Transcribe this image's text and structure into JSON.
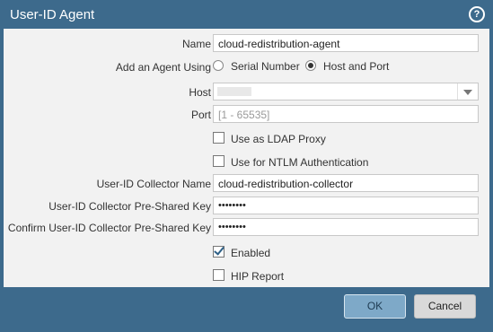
{
  "dialog": {
    "title": "User-ID Agent",
    "help_icon": "help-circle-icon"
  },
  "fields": {
    "name": {
      "label": "Name",
      "value": "cloud-redistribution-agent"
    },
    "add_agent_using": {
      "label": "Add an Agent Using",
      "options": [
        "Serial Number",
        "Host and Port"
      ],
      "selected": "Host and Port"
    },
    "host": {
      "label": "Host",
      "value": ""
    },
    "port": {
      "label": "Port",
      "placeholder": "[1 - 65535]"
    },
    "use_ldap_proxy": {
      "label": "Use as LDAP Proxy",
      "checked": false
    },
    "use_ntlm": {
      "label": "Use for NTLM Authentication",
      "checked": false
    },
    "collector_name": {
      "label": "User-ID Collector Name",
      "value": "cloud-redistribution-collector"
    },
    "pre_shared_key": {
      "label": "User-ID Collector Pre-Shared Key",
      "value": "••••••••"
    },
    "confirm_pre_shared_key": {
      "label": "Confirm User-ID Collector Pre-Shared Key",
      "value": "••••••••"
    },
    "enabled": {
      "label": "Enabled",
      "checked": true
    },
    "hip_report": {
      "label": "HIP Report",
      "checked": false
    }
  },
  "buttons": {
    "ok": "OK",
    "cancel": "Cancel"
  },
  "colors": {
    "header_bg": "#3d6a8c",
    "body_bg": "#f2f2f2",
    "ok_bg": "#7ea9c8"
  }
}
